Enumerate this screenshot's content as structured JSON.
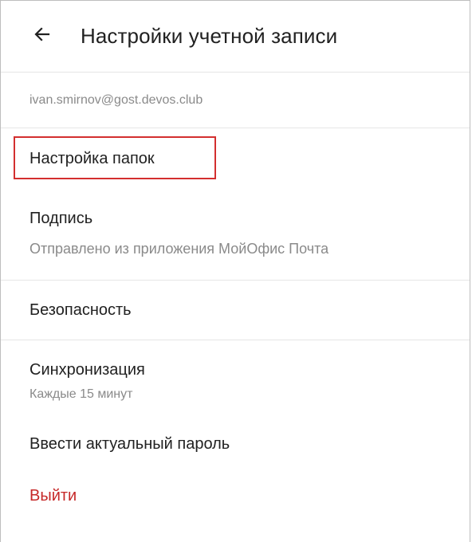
{
  "header": {
    "back_icon": "arrow-left-icon",
    "title": "Настройки учетной записи"
  },
  "account": {
    "email": "ivan.smirnov@gost.devos.club"
  },
  "settings": {
    "folders": {
      "label": "Настройка папок",
      "highlight_color": "#d32f2f"
    },
    "signature": {
      "label": "Подпись",
      "value": "Отправлено из приложения МойОфис Почта"
    },
    "security": {
      "label": "Безопасность"
    },
    "sync": {
      "label": "Синхронизация",
      "value": "Каждые 15 минут"
    },
    "password": {
      "label": "Ввести актуальный пароль"
    },
    "logout": {
      "label": "Выйти",
      "color": "#c62828"
    }
  }
}
